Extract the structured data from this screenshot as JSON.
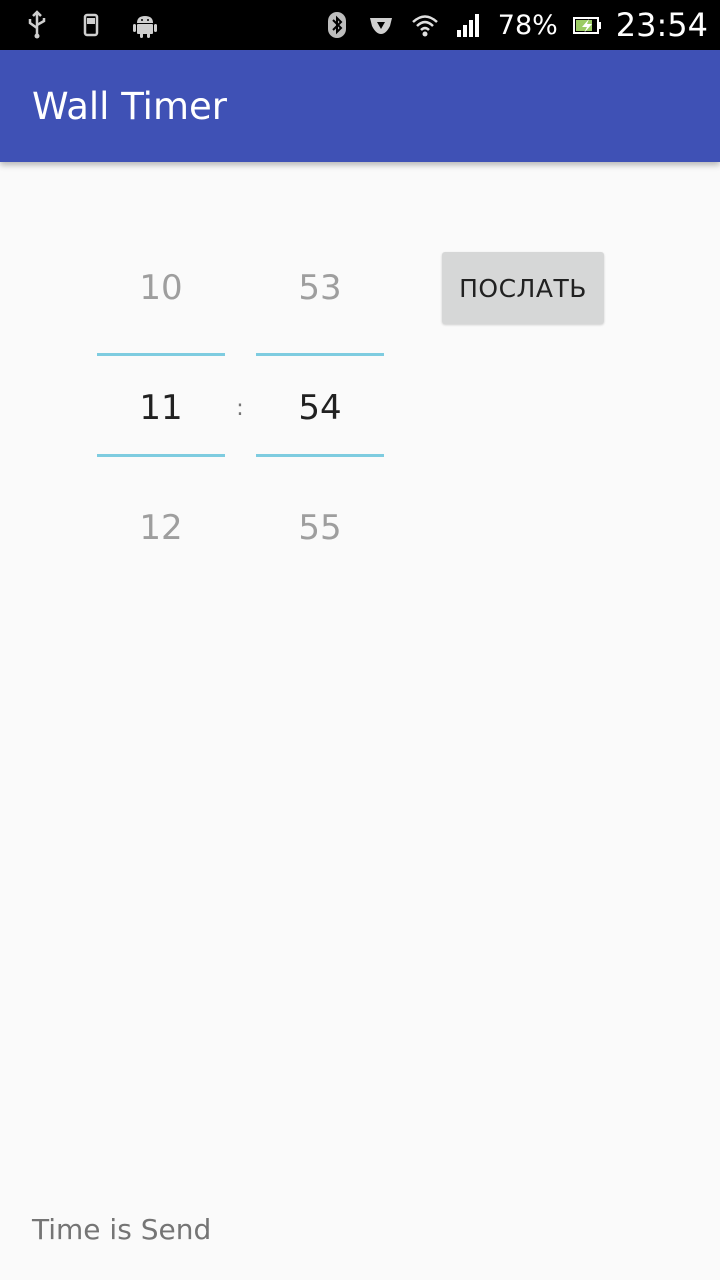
{
  "status_bar": {
    "left_icons": [
      "usb-icon",
      "phone-sync-icon",
      "android-icon"
    ],
    "right_icons": [
      "bluetooth-icon",
      "vpn-shield-icon",
      "wifi-icon",
      "signal-icon",
      "battery-charging-icon"
    ],
    "battery_percent": "78%",
    "time": "23:54"
  },
  "app_bar": {
    "title": "Wall Timer",
    "color": "#3f51b5"
  },
  "time_picker": {
    "hours": {
      "prev": "10",
      "selected": "11",
      "next": "12"
    },
    "separator": ":",
    "minutes": {
      "prev": "53",
      "selected": "54",
      "next": "55"
    },
    "divider_color": "#7ecce0"
  },
  "actions": {
    "send_label": "ПОСЛАТЬ"
  },
  "footer": {
    "status": "Time is Send"
  }
}
